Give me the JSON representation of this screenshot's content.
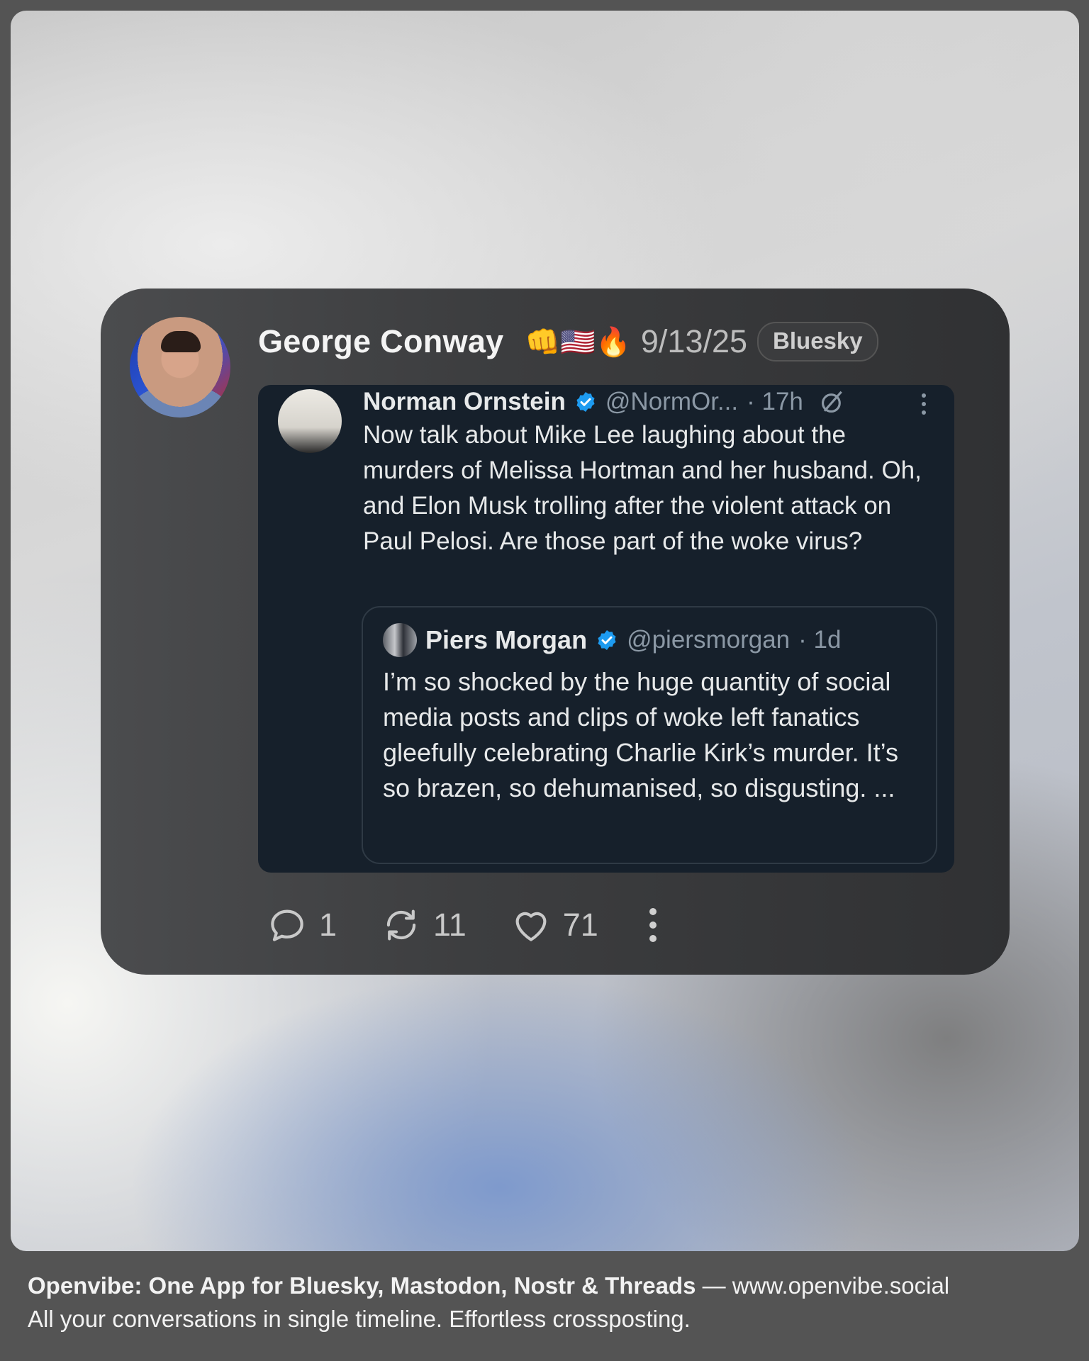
{
  "post": {
    "author": "George Conway",
    "emoji": "👊🇺🇸🔥",
    "date": "9/13/25",
    "network": "Bluesky",
    "actions": {
      "replies": "1",
      "reposts": "11",
      "likes": "71"
    }
  },
  "embedded_tweet": {
    "name": "Norman Ornstein",
    "handle": "@NormOr...",
    "time": "· 17h",
    "text": "Now talk about Mike Lee laughing about the murders of Melissa Hortman and her husband. Oh, and Elon Musk trolling after the violent attack on Paul Pelosi. Are those part of the woke virus?",
    "quote": {
      "name": "Piers Morgan",
      "handle": "@piersmorgan",
      "time": "· 1d",
      "text": "I’m so shocked by the huge quantity of social media posts and clips of woke left fanatics gleefully celebrating Charlie Kirk’s murder. It’s so brazen, so dehumanised, so disgusting. ..."
    }
  },
  "footer": {
    "headline": "Openvibe: One App for Bluesky, Mastodon, Nostr & Threads",
    "separator": " — ",
    "url": "www.openvibe.social",
    "tagline": "All your conversations in single timeline. Effortless crossposting."
  },
  "colors": {
    "card_bg": "#3d3e40",
    "tweet_bg": "#16202b",
    "verified_blue": "#1d9bf0"
  }
}
